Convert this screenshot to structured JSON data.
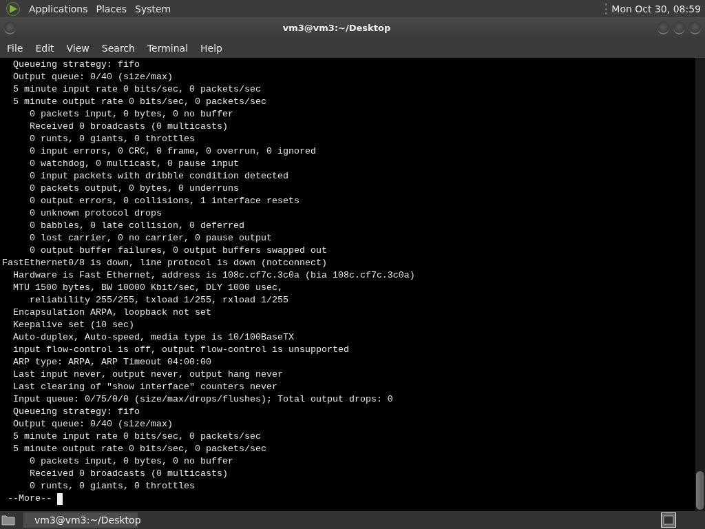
{
  "top_panel": {
    "menus": [
      "Applications",
      "Places",
      "System"
    ],
    "clock": "Mon Oct 30, 08:59"
  },
  "window": {
    "title": "vm3@vm3:~/Desktop",
    "menu": [
      "File",
      "Edit",
      "View",
      "Search",
      "Terminal",
      "Help"
    ],
    "terminal_lines": [
      "  Queueing strategy: fifo",
      "  Output queue: 0/40 (size/max)",
      "  5 minute input rate 0 bits/sec, 0 packets/sec",
      "  5 minute output rate 0 bits/sec, 0 packets/sec",
      "     0 packets input, 0 bytes, 0 no buffer",
      "     Received 0 broadcasts (0 multicasts)",
      "     0 runts, 0 giants, 0 throttles",
      "     0 input errors, 0 CRC, 0 frame, 0 overrun, 0 ignored",
      "     0 watchdog, 0 multicast, 0 pause input",
      "     0 input packets with dribble condition detected",
      "     0 packets output, 0 bytes, 0 underruns",
      "     0 output errors, 0 collisions, 1 interface resets",
      "     0 unknown protocol drops",
      "     0 babbles, 0 late collision, 0 deferred",
      "     0 lost carrier, 0 no carrier, 0 pause output",
      "     0 output buffer failures, 0 output buffers swapped out",
      "FastEthernet0/8 is down, line protocol is down (notconnect)",
      "  Hardware is Fast Ethernet, address is 108c.cf7c.3c0a (bia 108c.cf7c.3c0a)",
      "  MTU 1500 bytes, BW 10000 Kbit/sec, DLY 1000 usec,",
      "     reliability 255/255, txload 1/255, rxload 1/255",
      "  Encapsulation ARPA, loopback not set",
      "  Keepalive set (10 sec)",
      "  Auto-duplex, Auto-speed, media type is 10/100BaseTX",
      "  input flow-control is off, output flow-control is unsupported",
      "  ARP type: ARPA, ARP Timeout 04:00:00",
      "  Last input never, output never, output hang never",
      "  Last clearing of \"show interface\" counters never",
      "  Input queue: 0/75/0/0 (size/max/drops/flushes); Total output drops: 0",
      "  Queueing strategy: fifo",
      "  Output queue: 0/40 (size/max)",
      "  5 minute input rate 0 bits/sec, 0 packets/sec",
      "  5 minute output rate 0 bits/sec, 0 packets/sec",
      "     0 packets input, 0 bytes, 0 no buffer",
      "     Received 0 broadcasts (0 multicasts)",
      "     0 runts, 0 giants, 0 throttles"
    ],
    "prompt": " --More-- "
  },
  "taskbar": {
    "tasks": [
      {
        "label": "vm3@vm3:~/Desktop",
        "selected": true
      }
    ]
  }
}
